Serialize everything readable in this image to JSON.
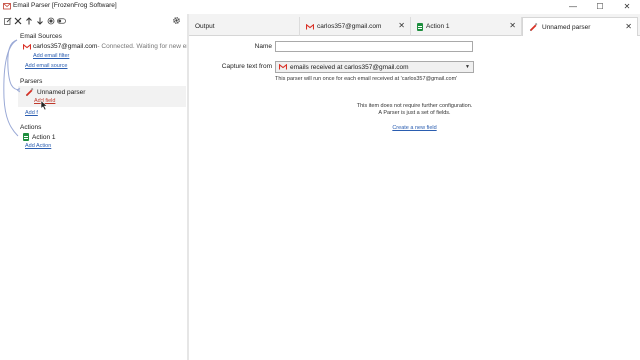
{
  "window": {
    "title": "Email Parser [FrozenFrog Software]",
    "minimize": "—",
    "maximize": "☐",
    "close": "✕"
  },
  "toolbar": {
    "icons": [
      "edit-icon",
      "delete-icon",
      "move-up-icon",
      "move-down-icon",
      "record-icon",
      "toggle-icon",
      "settings-icon"
    ]
  },
  "sidebar": {
    "email_sources_label": "Email Sources",
    "email_source": {
      "address": "carlos357@gmail.com",
      "status": " - Connected. Waiting for new em"
    },
    "add_email_filter": "Add email filter",
    "add_email_source": "Add email source",
    "parsers_label": "Parsers",
    "parser_name": "Unnamed parser",
    "add_field": "Add field",
    "add_field_2": "Add f",
    "actions_label": "Actions",
    "action_name": "Action 1",
    "add_action": "Add Action"
  },
  "tabs": [
    {
      "label": "Output",
      "close": "✕"
    },
    {
      "label": "carlos357@gmail.com",
      "close": "✕"
    },
    {
      "label": "Action 1",
      "close": "✕"
    },
    {
      "label": "Unnamed parser",
      "close": "✕"
    }
  ],
  "parser_form": {
    "name_label": "Name",
    "name_value": "",
    "capture_label": "Capture text from",
    "capture_value": "emails received at carlos357@gmail.com",
    "capture_hint": "This parser will run once for each email received at 'carlos357@gmail.com'",
    "info_line1": "This item does not require further configuration.",
    "info_line2": "A Parser is just a set of fields.",
    "create_link": "Create a new field"
  },
  "colors": {
    "link": "#2a5db0",
    "gmail_red": "#d93025",
    "green": "#1e8e3e",
    "tree_line": "#9aa9d6"
  }
}
